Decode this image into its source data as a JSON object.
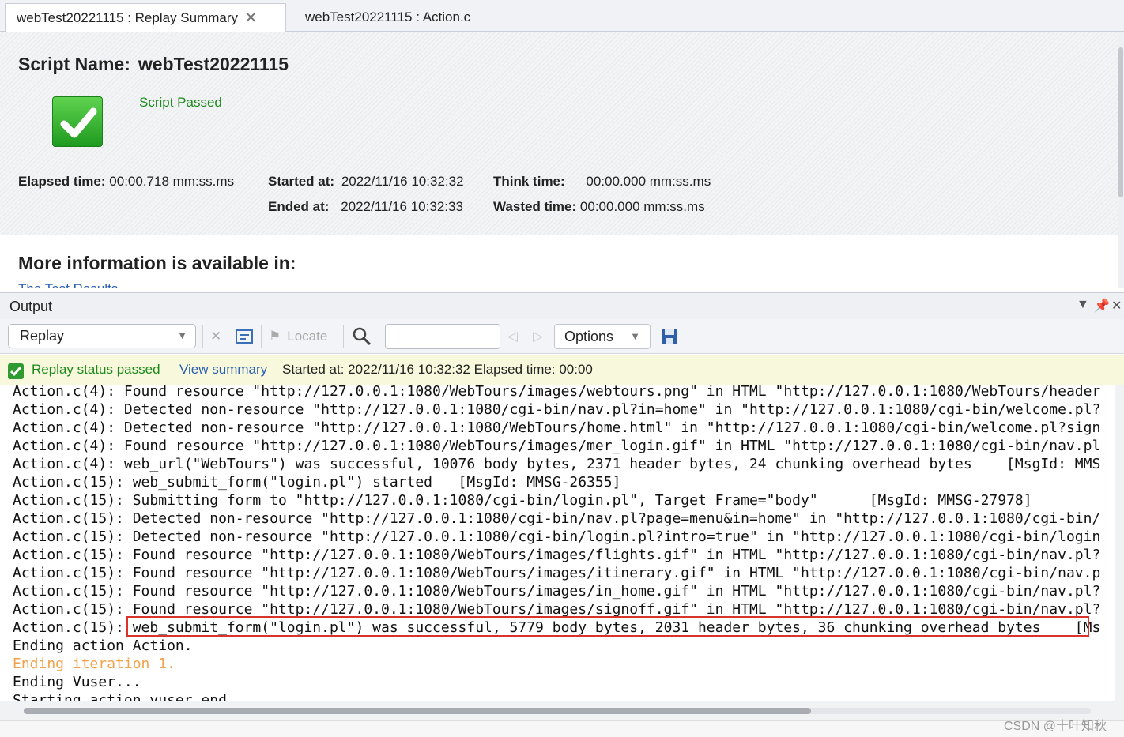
{
  "tabs": [
    {
      "label": "webTest20221115 : Replay Summary",
      "active": true
    },
    {
      "label": "webTest20221115 : Action.c",
      "active": false
    }
  ],
  "summary": {
    "script_name_label": "Script Name:",
    "script_name": "webTest20221115",
    "status": "Script Passed",
    "elapsed_label": "Elapsed time:",
    "elapsed_value": "00:00.718 mm:ss.ms",
    "started_label": "Started at:",
    "started_value": "2022/11/16 10:32:32",
    "ended_label": "Ended at:",
    "ended_value": "2022/11/16 10:32:33",
    "think_label": "Think time:",
    "think_value": "00:00.000 mm:ss.ms",
    "wasted_label": "Wasted time:",
    "wasted_value": "00:00.000 mm:ss.ms",
    "more_info": "More information is available in:",
    "more_info_link": "The Test Results"
  },
  "output": {
    "title": "Output",
    "select_value": "Replay",
    "locate_label": "Locate",
    "options_label": "Options",
    "search_value": ""
  },
  "status_bar": {
    "passed": "Replay status passed",
    "link": "View summary",
    "info": "Started at: 2022/11/16 10:32:32 Elapsed time: 00:00"
  },
  "log": {
    "lines": [
      "Action.c(4): Found resource \"http://127.0.0.1:1080/WebTours/images/webtours.png\" in HTML \"http://127.0.0.1:1080/WebTours/header",
      "Action.c(4): Detected non-resource \"http://127.0.0.1:1080/cgi-bin/nav.pl?in=home\" in \"http://127.0.0.1:1080/cgi-bin/welcome.pl?",
      "Action.c(4): Detected non-resource \"http://127.0.0.1:1080/WebTours/home.html\" in \"http://127.0.0.1:1080/cgi-bin/welcome.pl?sign",
      "Action.c(4): Found resource \"http://127.0.0.1:1080/WebTours/images/mer_login.gif\" in HTML \"http://127.0.0.1:1080/cgi-bin/nav.pl",
      "Action.c(4): web_url(\"WebTours\") was successful, 10076 body bytes, 2371 header bytes, 24 chunking overhead bytes    [MsgId: MMS",
      "Action.c(15): web_submit_form(\"login.pl\") started   [MsgId: MMSG-26355]",
      "Action.c(15): Submitting form to \"http://127.0.0.1:1080/cgi-bin/login.pl\", Target Frame=\"body\"      [MsgId: MMSG-27978]",
      "Action.c(15): Detected non-resource \"http://127.0.0.1:1080/cgi-bin/nav.pl?page=menu&in=home\" in \"http://127.0.0.1:1080/cgi-bin/",
      "Action.c(15): Detected non-resource \"http://127.0.0.1:1080/cgi-bin/login.pl?intro=true\" in \"http://127.0.0.1:1080/cgi-bin/login",
      "Action.c(15): Found resource \"http://127.0.0.1:1080/WebTours/images/flights.gif\" in HTML \"http://127.0.0.1:1080/cgi-bin/nav.pl?",
      "Action.c(15): Found resource \"http://127.0.0.1:1080/WebTours/images/itinerary.gif\" in HTML \"http://127.0.0.1:1080/cgi-bin/nav.p",
      "Action.c(15): Found resource \"http://127.0.0.1:1080/WebTours/images/in_home.gif\" in HTML \"http://127.0.0.1:1080/cgi-bin/nav.pl?",
      "Action.c(15): Found resource \"http://127.0.0.1:1080/WebTours/images/signoff.gif\" in HTML \"http://127.0.0.1:1080/cgi-bin/nav.pl?",
      "Action.c(15): web_submit_form(\"login.pl\") was successful, 5779 body bytes, 2031 header bytes, 36 chunking overhead bytes    [Ms",
      "Ending action Action.",
      "Ending iteration 1.",
      "Ending Vuser...",
      "Starting action vuser_end."
    ]
  },
  "watermark": "CSDN @十叶知秋",
  "colors": {
    "pass_green": "#1b8a1b",
    "link_blue": "#2b5fb3",
    "highlight_red": "#d9342b",
    "iteration_orange": "#f2a24a",
    "status_bg": "#f8f8dc"
  },
  "icons": [
    "close-icon",
    "pass-check-icon",
    "pin-icon",
    "dropdown-icon",
    "clear-icon",
    "wrap-icon",
    "locate-flag-icon",
    "search-icon",
    "prev-icon",
    "next-icon",
    "save-icon"
  ]
}
